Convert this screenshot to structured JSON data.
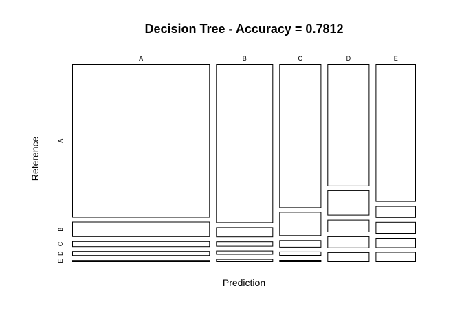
{
  "chart_data": {
    "type": "mosaic",
    "title": "Decision Tree - Accuracy = 0.7812",
    "xlabel": "Prediction",
    "ylabel": "Reference",
    "prediction_labels": [
      "A",
      "B",
      "C",
      "D",
      "E"
    ],
    "reference_labels": [
      "A",
      "B",
      "C",
      "D",
      "E"
    ],
    "prediction_totals": [
      1640,
      680,
      500,
      500,
      480
    ],
    "proportions": [
      [
        0.8,
        0.08,
        0.03,
        0.025,
        0.01
      ],
      [
        0.78,
        0.05,
        0.025,
        0.02,
        0.015
      ],
      [
        0.69,
        0.115,
        0.035,
        0.02,
        0.01
      ],
      [
        0.63,
        0.13,
        0.065,
        0.06,
        0.05
      ],
      [
        0.76,
        0.065,
        0.065,
        0.055,
        0.055
      ]
    ]
  }
}
